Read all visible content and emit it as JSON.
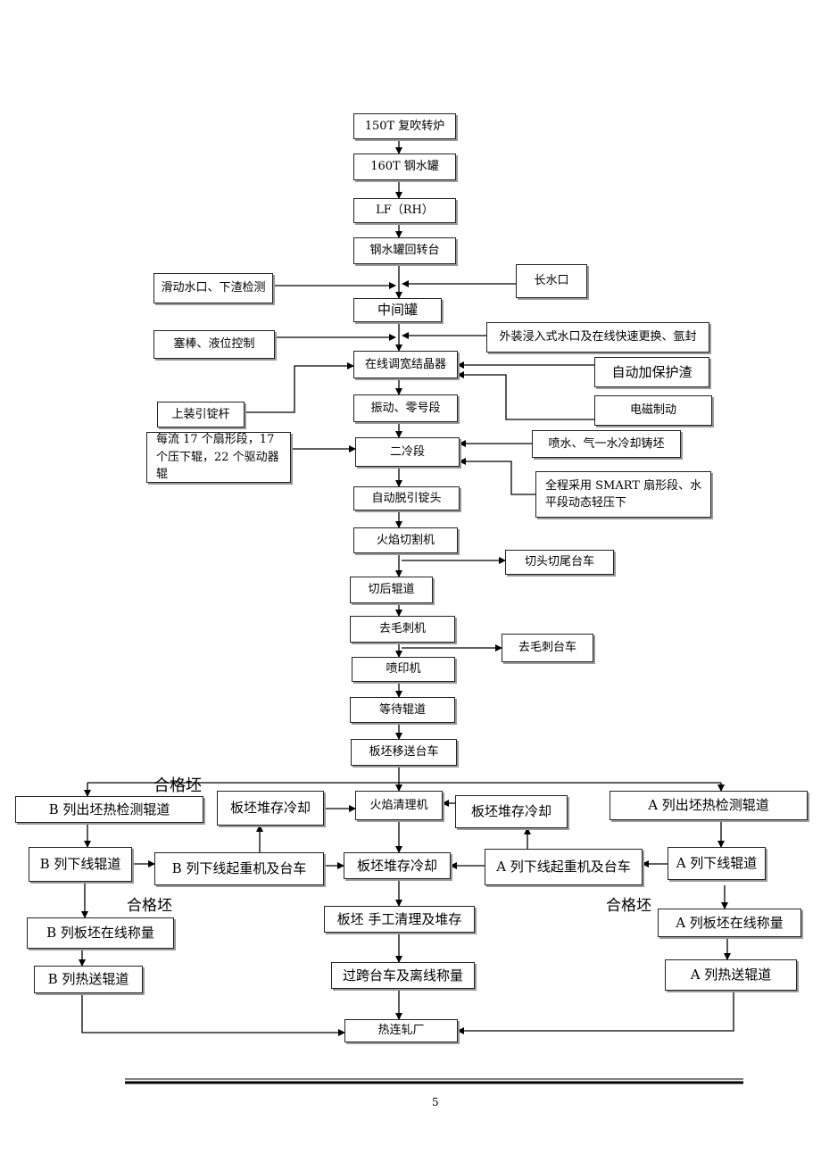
{
  "nodes": {
    "n1": "150T 复吹转炉",
    "n2": "160T 钢水罐",
    "n3": "LF（RH）",
    "n4": "钢水罐回转台",
    "n5": "滑动水口、下渣检测",
    "n6": "长水口",
    "n7": "中间罐",
    "n8": "塞棒、液位控制",
    "n9": "外装浸入式水口及在线快速更换、氩封",
    "n10": "在线调宽结晶器",
    "n11": "自动加保护渣",
    "n12": "上装引锭杆",
    "n13": "振动、零号段",
    "n14": "电磁制动",
    "n15": "每流 17 个扇形段，17 个压下辊，22 个驱动器辊",
    "n16": "二冷段",
    "n17": "喷水、气一水冷却铸坯",
    "n18": "全程采用 SMART 扇形段、水平段动态轻压下",
    "n19": "自动脱引锭头",
    "n20": "火焰切割机",
    "n21": "切头切尾台车",
    "n22": "切后辊道",
    "n23": "去毛刺机",
    "n24": "去毛刺台车",
    "n25": "喷印机",
    "n26": "等待辊道",
    "n27": "板坯移送台车",
    "n28": "B 列出坯热检测辊道",
    "n29": "板坯堆存冷却",
    "n30": "火焰清理机",
    "n31": "板坯堆存冷却",
    "n32": "A 列出坯热检测辊道",
    "n33": "B 列下线辊道",
    "n34": "B 列下线起重机及台车",
    "n35": "板坯堆存冷却",
    "n36": "A 列下线起重机及台车",
    "n37": "A 列下线辊道",
    "n38": "B 列板坯在线称量",
    "n39": "板坯  手工清理及堆存",
    "n40": "A 列板坯在线称量",
    "n41": "B 列热送辊道",
    "n42": "过跨台车及离线称量",
    "n43": "A 列热送辊道",
    "n44": "热连轧厂"
  },
  "labels": {
    "qualified_top": "合格坯",
    "qualified_left": "合格坯",
    "qualified_right": "合格坯"
  },
  "page_number": "5"
}
